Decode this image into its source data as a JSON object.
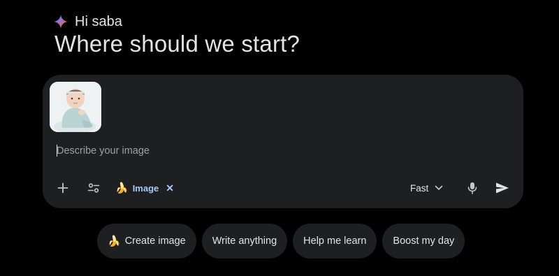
{
  "greeting": {
    "name_line": "Hi saba",
    "headline": "Where should we start?"
  },
  "composer": {
    "attachment": {
      "icon": "baby-photo-thumbnail"
    },
    "prompt_placeholder": "Describe your image",
    "prompt_value": "",
    "toolbar": {
      "add_icon": "plus-icon",
      "tools_icon": "sliders-icon",
      "active_tool": {
        "emoji": "🍌",
        "label": "Image",
        "remove_symbol": "✕"
      },
      "model_label": "Fast",
      "mic_icon": "microphone-icon",
      "send_icon": "send-icon"
    }
  },
  "suggestions": [
    {
      "emoji": "🍌",
      "label": "Create image"
    },
    {
      "emoji": "",
      "label": "Write anything"
    },
    {
      "emoji": "",
      "label": "Help me learn"
    },
    {
      "emoji": "",
      "label": "Boost my day"
    }
  ],
  "colors": {
    "background": "#000000",
    "surface": "#1e1f20",
    "accent": "#a8c7fa",
    "text": "#e3e3e3"
  }
}
